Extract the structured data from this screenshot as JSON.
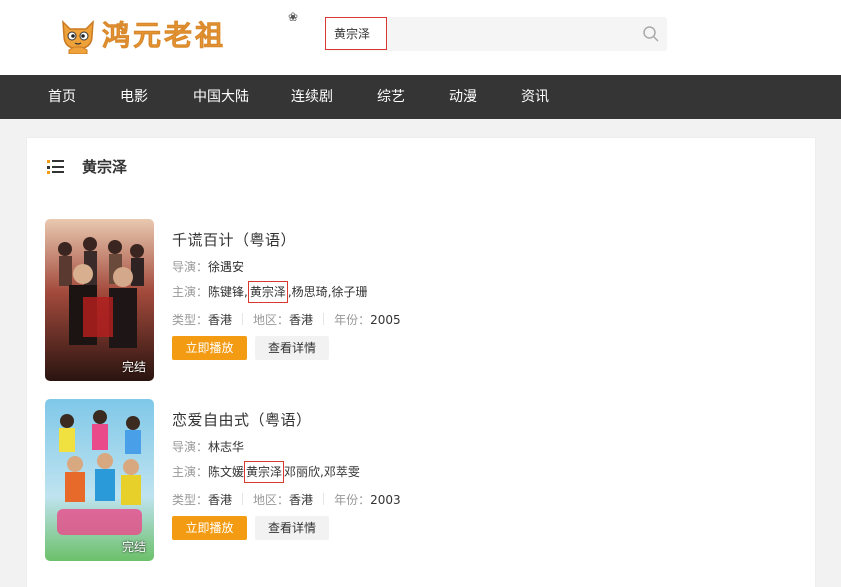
{
  "header": {
    "logo_text": "鸿元老祖",
    "search": {
      "value": "黄宗泽",
      "placeholder": ""
    }
  },
  "nav": {
    "items": [
      {
        "label": "首页"
      },
      {
        "label": "电影"
      },
      {
        "label": "中国大陆"
      },
      {
        "label": "连续剧"
      },
      {
        "label": "综艺"
      },
      {
        "label": "动漫"
      },
      {
        "label": "资讯"
      }
    ]
  },
  "results": {
    "heading": "黄宗泽",
    "items": [
      {
        "title": "千谎百计（粤语）",
        "director_label": "导演：",
        "director": "徐遇安",
        "cast_label": "主演：",
        "cast_before": "陈键锋,",
        "cast_highlight": "黄宗泽",
        "cast_after": ",杨思琦,徐子珊",
        "type_label": "类型：",
        "type": "香港",
        "region_label": "地区：",
        "region": "香港",
        "year_label": "年份：",
        "year": "2005",
        "badge": "完结",
        "play_label": "立即播放",
        "detail_label": "查看详情"
      },
      {
        "title": "恋爱自由式（粤语）",
        "director_label": "导演：",
        "director": "林志华",
        "cast_label": "主演：",
        "cast_before": "陈文媛",
        "cast_highlight": "黄宗泽",
        "cast_after": "邓丽欣,邓萃雯",
        "type_label": "类型：",
        "type": "香港",
        "region_label": "地区：",
        "region": "香港",
        "year_label": "年份：",
        "year": "2003",
        "badge": "完结",
        "play_label": "立即播放",
        "detail_label": "查看详情"
      }
    ]
  },
  "colors": {
    "accent": "#f39b12",
    "nav_bg": "#353535",
    "highlight_border": "#d9382f",
    "logo": "#f0a23a"
  },
  "icons": {
    "search": "search-icon",
    "list": "list-icon",
    "logo": "cat-logo-icon"
  }
}
